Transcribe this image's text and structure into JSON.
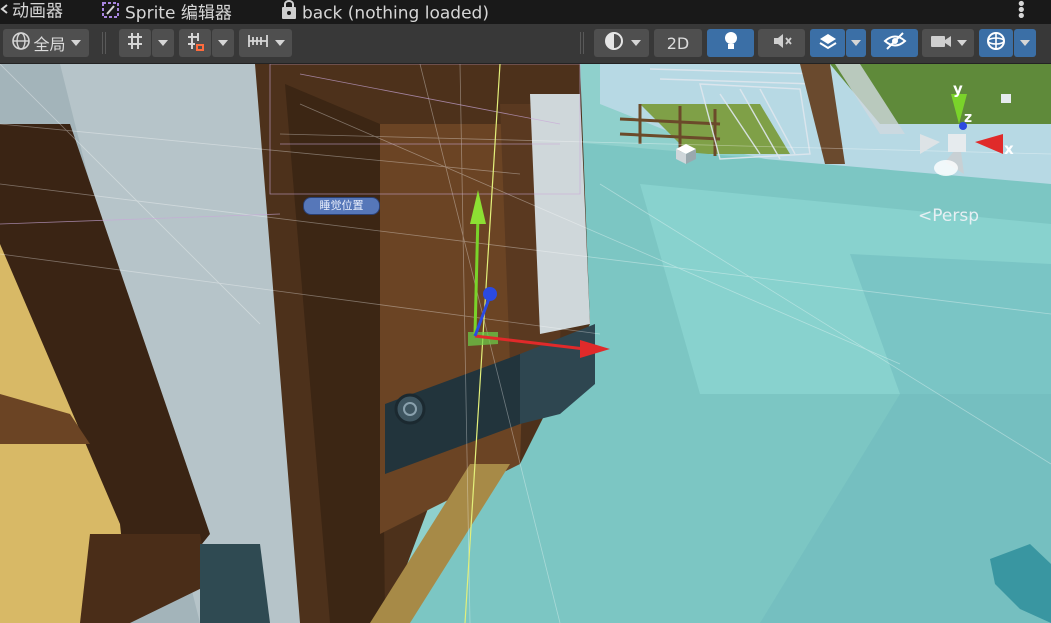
{
  "tabs": [
    {
      "label": "动画器",
      "icon": "animator-icon"
    },
    {
      "label": "Sprite 编辑器",
      "icon": "sprite-editor-icon"
    },
    {
      "label": "back (nothing loaded)",
      "icon": "lock-icon"
    }
  ],
  "toolbar": {
    "pivot_mode": "全局",
    "view_2d_label": "2D",
    "icons": [
      "globe-icon",
      "grid-snap-icon",
      "increment-snap-icon",
      "ruler-icon",
      "draw-mode-icon",
      "lighting-icon",
      "audio-mute-icon",
      "effects-icon",
      "scene-visibility-icon",
      "camera-icon",
      "gizmos-icon"
    ]
  },
  "scene": {
    "object_label": "睡觉位置",
    "projection": "Persp",
    "gizmo_axes": {
      "x": "x",
      "y": "y",
      "z": "z"
    },
    "colors": {
      "tab_bg": "#191919",
      "toolbar_bg": "#383838",
      "active_button": "#3b6fa6",
      "water": "#7fc9c7",
      "wood": "#6b4424",
      "x_axis": "#e02a2a",
      "y_axis": "#7ad32a",
      "z_axis": "#2b4ae0"
    }
  }
}
